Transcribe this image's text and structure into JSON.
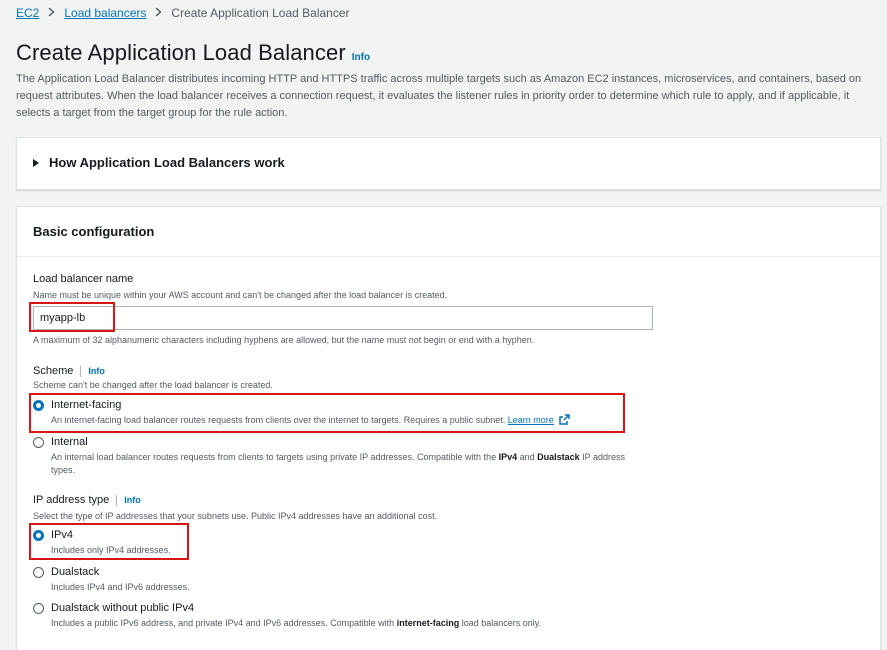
{
  "breadcrumb": {
    "items": [
      "EC2",
      "Load balancers"
    ],
    "current": "Create Application Load Balancer"
  },
  "page": {
    "title": "Create Application Load Balancer",
    "info_label": "Info",
    "description": "The Application Load Balancer distributes incoming HTTP and HTTPS traffic across multiple targets such as Amazon EC2 instances, microservices, and containers, based on request attributes. When the load balancer receives a connection request, it evaluates the listener rules in priority order to determine which rule to apply, and if applicable, it selects a target from the target group for the rule action."
  },
  "expander": {
    "title": "How Application Load Balancers work"
  },
  "basic_config": {
    "title": "Basic configuration",
    "name_field": {
      "label": "Load balancer name",
      "description": "Name must be unique within your AWS account and can't be changed after the load balancer is created.",
      "value": "myapp-lb",
      "constraint": "A maximum of 32 alphanumeric characters including hyphens are allowed, but the name must not begin or end with a hyphen."
    },
    "scheme": {
      "label": "Scheme",
      "info_label": "Info",
      "description": "Scheme can't be changed after the load balancer is created.",
      "options": [
        {
          "label": "Internet-facing",
          "desc": "An internet-facing load balancer routes requests from clients over the internet to targets. Requires a public subnet.",
          "learn_more": "Learn more",
          "selected": true
        },
        {
          "label": "Internal",
          "desc_pre": "An internal load balancer routes requests from clients to targets using private IP addresses. Compatible with the ",
          "desc_b1": "IPv4",
          "desc_mid": " and ",
          "desc_b2": "Dualstack",
          "desc_post": " IP address types.",
          "selected": false
        }
      ]
    },
    "ip_type": {
      "label": "IP address type",
      "info_label": "Info",
      "description": "Select the type of IP addresses that your subnets use. Public IPv4 addresses have an additional cost.",
      "options": [
        {
          "label": "IPv4",
          "desc": "Includes only IPv4 addresses.",
          "selected": true
        },
        {
          "label": "Dualstack",
          "desc": "Includes IPv4 and IPv6 addresses.",
          "selected": false
        },
        {
          "label": "Dualstack without public IPv4",
          "desc_pre": "Includes a public IPv6 address, and private IPv4 and IPv6 addresses. Compatible with ",
          "desc_b": "internet-facing",
          "desc_post": " load balancers only.",
          "selected": false
        }
      ]
    }
  },
  "colors": {
    "link": "#0073bb",
    "highlight": "#d91515",
    "background": "#f2f3f3"
  },
  "icons": {
    "breadcrumb_separator": "chevron-right-icon",
    "expander": "caret-right-icon",
    "external": "external-link-icon"
  }
}
